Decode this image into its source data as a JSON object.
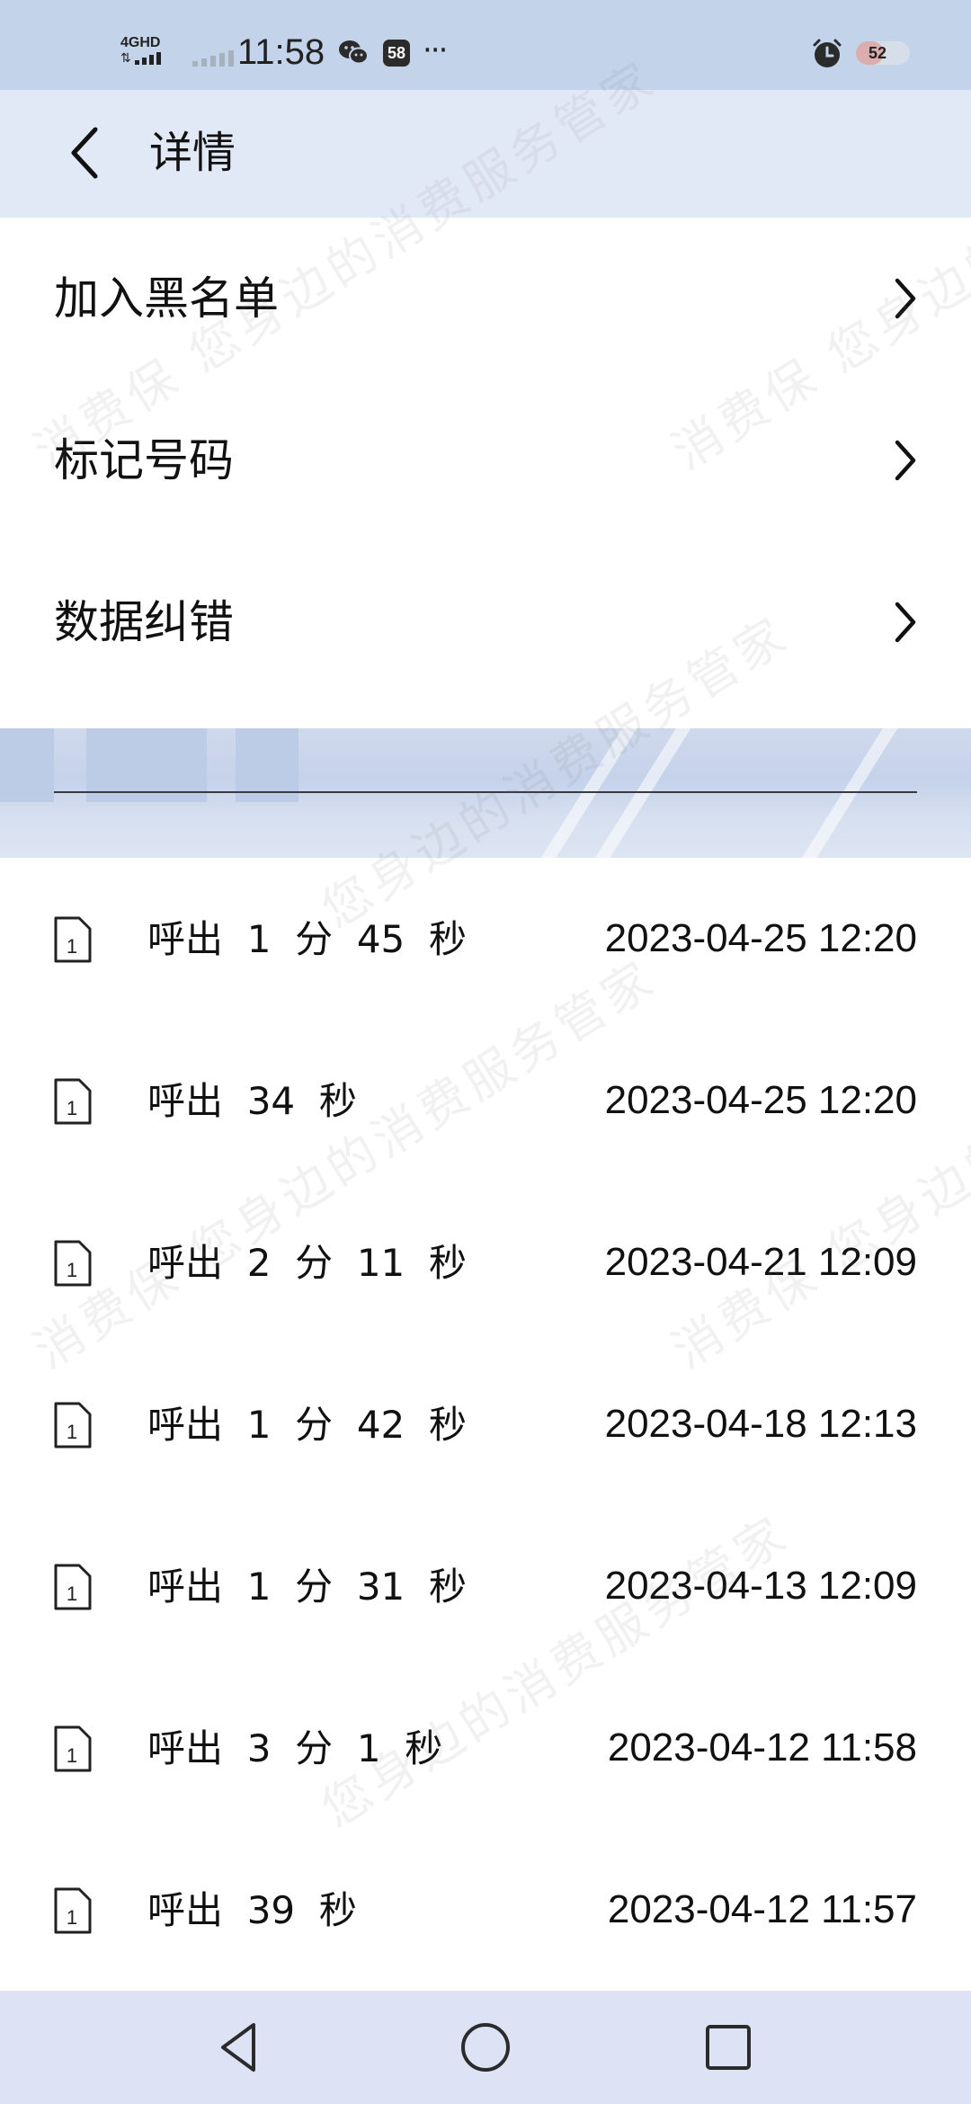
{
  "status_bar": {
    "network": "4GHD",
    "time": "11:58",
    "notification_badge": "58",
    "more": "···",
    "battery": "52",
    "battery_level": 0.52
  },
  "header": {
    "title": "详情"
  },
  "menu": [
    {
      "label": "加入黑名单"
    },
    {
      "label": "标记号码"
    },
    {
      "label": "数据纠错"
    }
  ],
  "calls": [
    {
      "description": "呼出  1  分  45  秒",
      "datetime": "2023-04-25 12:20",
      "sim": "1"
    },
    {
      "description": "呼出  34  秒",
      "datetime": "2023-04-25 12:20",
      "sim": "1"
    },
    {
      "description": "呼出  2  分  11  秒",
      "datetime": "2023-04-21 12:09",
      "sim": "1"
    },
    {
      "description": "呼出  1  分  42  秒",
      "datetime": "2023-04-18 12:13",
      "sim": "1"
    },
    {
      "description": "呼出  1  分  31  秒",
      "datetime": "2023-04-13 12:09",
      "sim": "1"
    },
    {
      "description": "呼出  3  分  1  秒",
      "datetime": "2023-04-12 11:58",
      "sim": "1"
    },
    {
      "description": "呼出  39  秒",
      "datetime": "2023-04-12 11:57",
      "sim": "1"
    }
  ],
  "watermark": {
    "line1": "消费保 您身边的消费服务管家",
    "line2": "您身边的消费服务管家"
  },
  "colors": {
    "status_bar_bg": "#c3d3ea",
    "header_bg": "#e2e9f6",
    "nav_bar_bg": "#dde3f5",
    "battery_accent": "#e5533d"
  }
}
